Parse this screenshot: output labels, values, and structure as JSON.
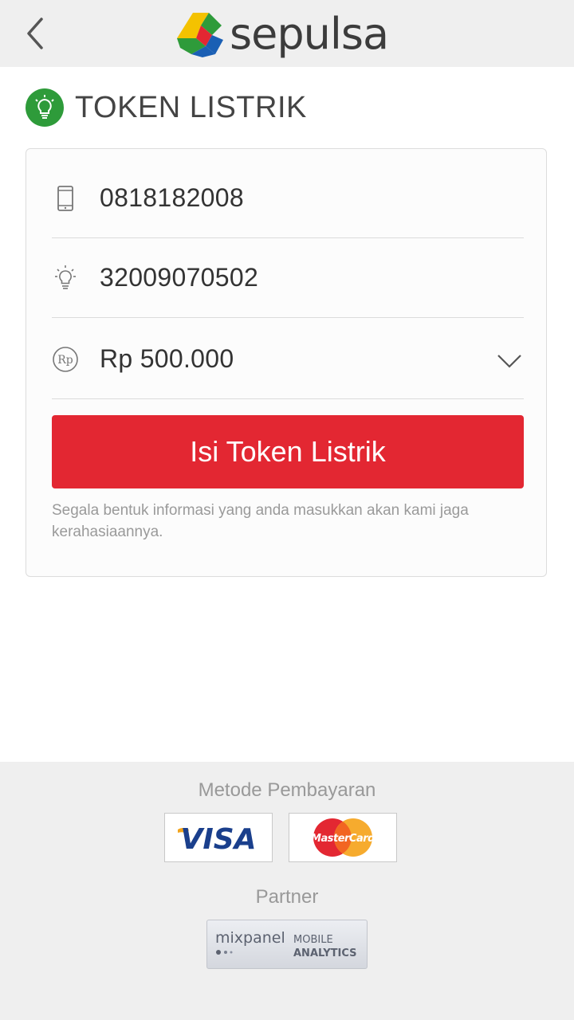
{
  "header": {
    "back_icon": "chevron-left-icon",
    "logo_text": "sepulsa"
  },
  "page": {
    "title": "TOKEN LISTRIK",
    "title_icon": "lightbulb-icon"
  },
  "form": {
    "phone": {
      "icon": "mobile-phone-icon",
      "value": "0818182008"
    },
    "meter": {
      "icon": "lightbulb-icon",
      "value": "32009070502"
    },
    "amount": {
      "icon": "rupiah-icon",
      "icon_label": "Rp",
      "value": "Rp 500.000",
      "dropdown_icon": "chevron-down-icon"
    },
    "submit_label": "Isi Token Listrik",
    "privacy_note": "Segala bentuk informasi yang anda masukkan akan kami jaga kerahasiaannya."
  },
  "footer": {
    "payment_title": "Metode Pembayaran",
    "payment_methods": [
      {
        "name": "VISA"
      },
      {
        "name": "MasterCard"
      }
    ],
    "partner_title": "Partner",
    "partner": {
      "name": "mixpanel",
      "tagline_line1": "MOBILE",
      "tagline_line2": "ANALYTICS"
    }
  },
  "colors": {
    "accent_red": "#e32732",
    "brand_green": "#2e9b3a",
    "visa_blue": "#1a3f8c"
  }
}
